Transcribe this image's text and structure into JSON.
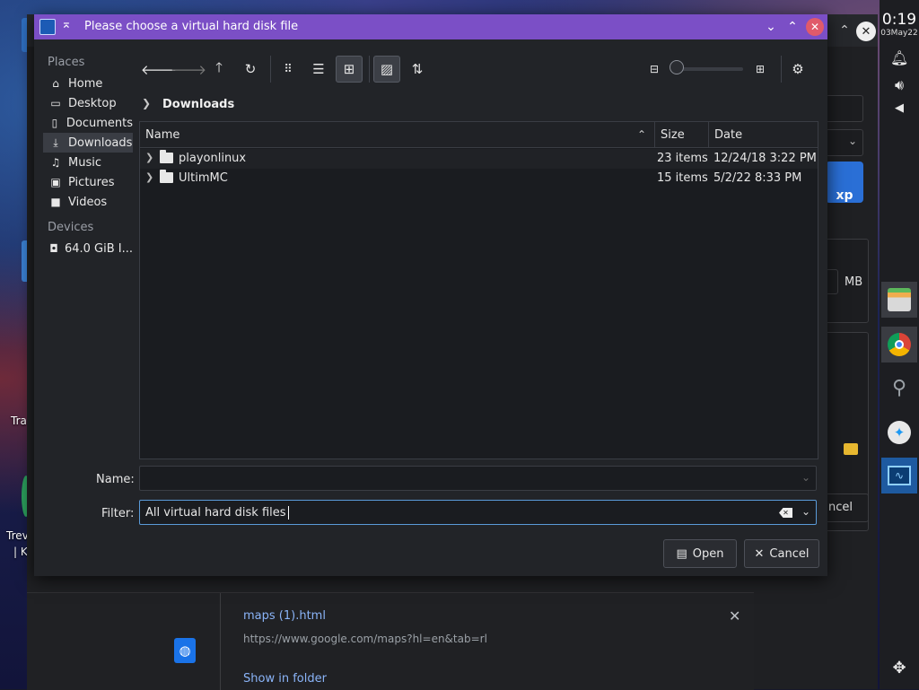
{
  "dialog": {
    "title": "Please choose a virtual hard disk file",
    "places_heading": "Places",
    "devices_heading": "Devices",
    "places": [
      {
        "label": "Home"
      },
      {
        "label": "Desktop"
      },
      {
        "label": "Documents"
      },
      {
        "label": "Downloads",
        "selected": true
      },
      {
        "label": "Music"
      },
      {
        "label": "Pictures"
      },
      {
        "label": "Videos"
      }
    ],
    "devices": [
      {
        "label": "64.0 GiB I..."
      }
    ],
    "breadcrumb": "Downloads",
    "columns": {
      "name": "Name",
      "size": "Size",
      "date": "Date"
    },
    "files": [
      {
        "name": "playonlinux",
        "size": "23 items",
        "date": "12/24/18 3:22 PM"
      },
      {
        "name": "UltimMC",
        "size": "15 items",
        "date": "5/2/22 8:33 PM"
      }
    ],
    "name_label": "Name:",
    "name_value": "",
    "filter_label": "Filter:",
    "filter_value": "All virtual hard disk files",
    "open_label": "Open",
    "cancel_label": "Cancel"
  },
  "background": {
    "unit_label": "MB",
    "cancel_fragment": "ncel",
    "download": {
      "title": "maps (1).html",
      "url": "https://www.google.com/maps?hl=en&tab=rl",
      "show_label": "Show in folder"
    },
    "desktop_labels": [
      "Tra",
      "Trev",
      "| K"
    ]
  },
  "panel": {
    "time": "0:19",
    "date": "03May22"
  },
  "colors": {
    "titlebar": "#7b4fc6",
    "dialog_bg": "#222428",
    "list_bg": "#1a1c20",
    "link": "#8ab4f8"
  }
}
